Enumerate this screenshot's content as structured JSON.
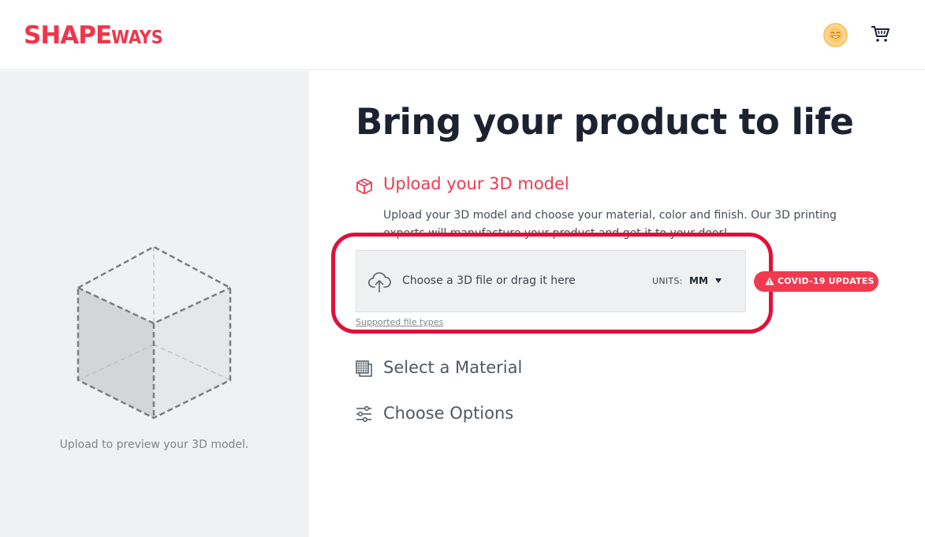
{
  "header": {
    "logo_primary": "SHAPE",
    "logo_secondary": "WAYS",
    "avatar_icon": "smiley-avatar-icon",
    "cart_icon": "shopping-cart-icon"
  },
  "preview": {
    "caption": "Upload to preview your 3D model.",
    "icon": "dashed-cube-icon"
  },
  "main": {
    "title": "Bring your product to life",
    "step1": {
      "icon": "cube-icon",
      "title": "Upload your 3D model",
      "desc_line1": "Upload your 3D model and choose your material, color and finish. Our 3D printing",
      "desc_line2": "experts will manufacture your product and get it to your door!"
    },
    "upload": {
      "icon": "cloud-upload-icon",
      "label": "Choose a 3D file or drag it here",
      "units_label": "UNITS:",
      "units_value": "MM",
      "supported_link": "Supported file types"
    },
    "covid_badge": "COVID-19 UPDATES",
    "step2": {
      "icon": "material-icon",
      "title": "Select a Material"
    },
    "step3": {
      "icon": "sliders-icon",
      "title": "Choose Options"
    }
  },
  "colors": {
    "brand": "#f0354b",
    "highlight": "#e0103a",
    "title": "#1c2230"
  }
}
